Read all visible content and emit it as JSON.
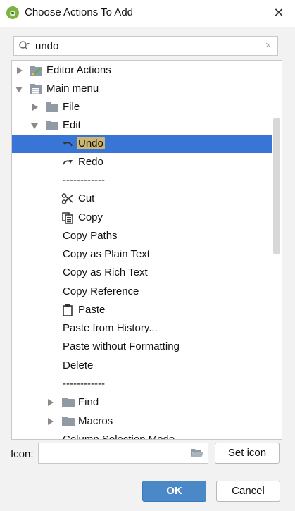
{
  "window": {
    "title": "Choose Actions To Add",
    "close": "✕"
  },
  "search": {
    "value": "undo",
    "clear": "×"
  },
  "tree": {
    "editor_actions": "Editor Actions",
    "main_menu": "Main menu",
    "file": "File",
    "edit": "Edit",
    "undo": "Undo",
    "redo": "Redo",
    "sep1": "------------",
    "cut": "Cut",
    "copy": "Copy",
    "copy_paths": "Copy Paths",
    "copy_plain": "Copy as Plain Text",
    "copy_rich": "Copy as Rich Text",
    "copy_ref": "Copy Reference",
    "paste": "Paste",
    "paste_history": "Paste from History...",
    "paste_noformat": "Paste without Formatting",
    "delete": "Delete",
    "sep2": "------------",
    "find": "Find",
    "macros": "Macros",
    "column_sel": "Column Selection Mode"
  },
  "bottom": {
    "icon_label": "Icon:",
    "set_icon": "Set icon",
    "ok": "OK",
    "cancel": "Cancel"
  },
  "colors": {
    "selection": "#3875d7",
    "highlight": "#ccb672",
    "ok_button": "#4a88c7"
  }
}
